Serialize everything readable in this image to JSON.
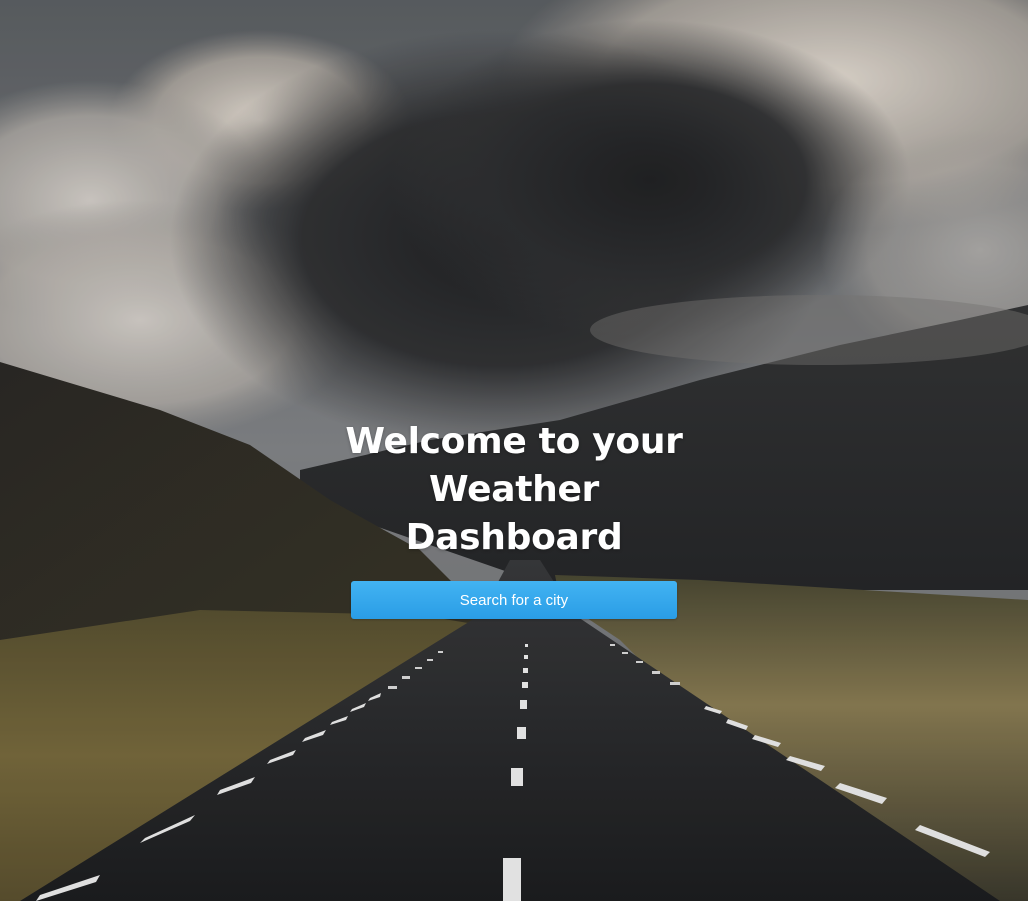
{
  "hero": {
    "title": "Welcome to your Weather Dashboard",
    "search_button_label": "Search for a city"
  },
  "colors": {
    "button_accent": "#36a9ee",
    "title_text": "#ffffff"
  }
}
